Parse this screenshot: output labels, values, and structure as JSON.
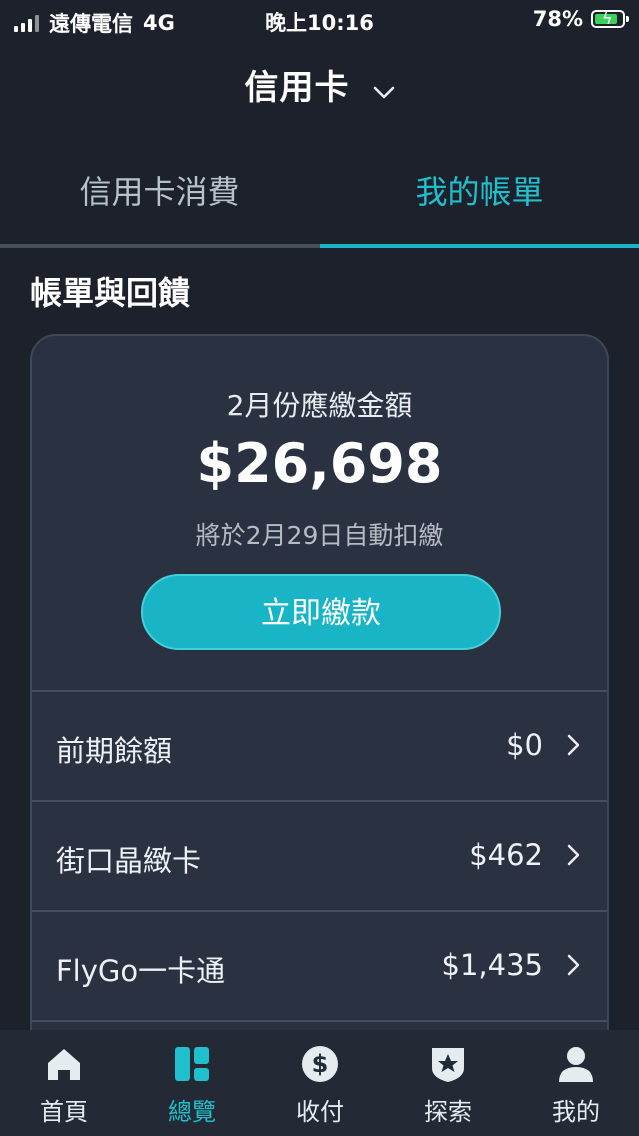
{
  "status_bar": {
    "carrier": "遠傳電信",
    "network": "4G",
    "time": "晚上10:16",
    "battery": "78%",
    "battery_color": "#3bd15a"
  },
  "header": {
    "title": "信用卡",
    "dropdown_icon": "chevron-down-icon"
  },
  "tabs": [
    {
      "label": "信用卡消費",
      "active": false
    },
    {
      "label": "我的帳單",
      "active": true
    }
  ],
  "section": {
    "title": "帳單與回饋"
  },
  "bill": {
    "due_label": "2月份應繳金額",
    "amount": "$26,698",
    "autopay_note": "將於2月29日自動扣繳",
    "pay_button": "立即繳款"
  },
  "rows": [
    {
      "label": "前期餘額",
      "value": "$0"
    },
    {
      "label": "街口晶緻卡",
      "value": "$462"
    },
    {
      "label": "FlyGo一卡通",
      "value": "$1,435"
    }
  ],
  "tabbar": [
    {
      "label": "首頁",
      "icon": "home-icon"
    },
    {
      "label": "總覽",
      "icon": "overview-icon",
      "active": true
    },
    {
      "label": "收付",
      "icon": "dollar-icon"
    },
    {
      "label": "探索",
      "icon": "star-badge-icon"
    },
    {
      "label": "我的",
      "icon": "user-icon"
    }
  ],
  "colors": {
    "accent": "#19b4c6",
    "background": "#1c212b",
    "card": "#2a3241"
  }
}
